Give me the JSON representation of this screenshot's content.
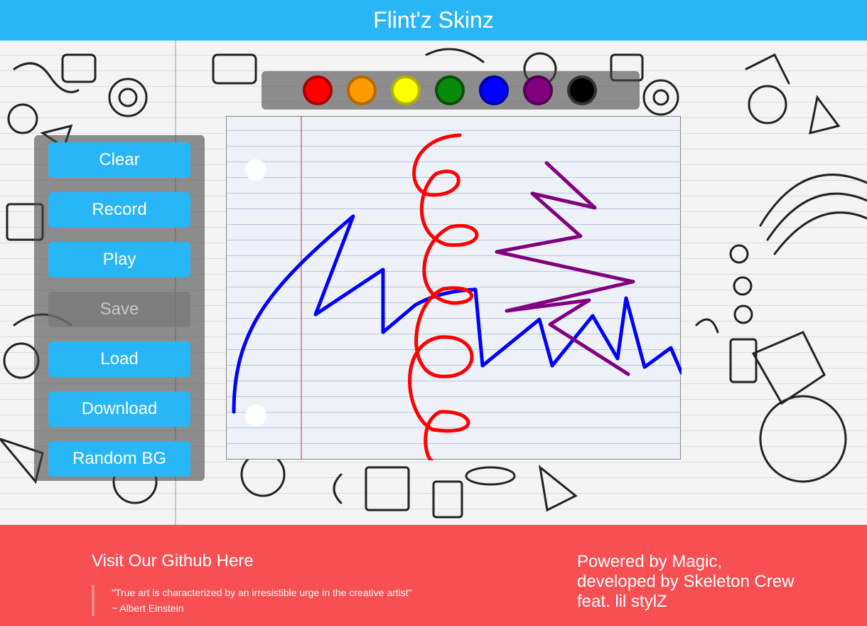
{
  "header": {
    "title": "Flint'z Skinz"
  },
  "palette": [
    {
      "name": "red",
      "color": "#ff0000"
    },
    {
      "name": "orange",
      "color": "#ff9900"
    },
    {
      "name": "yellow",
      "color": "#ffff00"
    },
    {
      "name": "green",
      "color": "#0a8a0a"
    },
    {
      "name": "blue",
      "color": "#0000ff"
    },
    {
      "name": "purple",
      "color": "#800080"
    },
    {
      "name": "black",
      "color": "#000000"
    }
  ],
  "controls": {
    "clear": "Clear",
    "record": "Record",
    "play": "Play",
    "save": "Save",
    "load": "Load",
    "download": "Download",
    "random_bg": "Random BG"
  },
  "footer": {
    "github_link": "Visit Our Github Here",
    "quote": "\"True art is characterized by an irresistible urge in the creative artist\"",
    "quote_author": "~ Albert Einstein",
    "credits_line1": "Powered by Magic,",
    "credits_line2": "developed by Skeleton Crew",
    "credits_line3": "feat. lil stylZ"
  },
  "colors": {
    "header_bg": "#29b6f6",
    "button_bg": "#29b6f6",
    "footer_bg": "#f74f52"
  }
}
